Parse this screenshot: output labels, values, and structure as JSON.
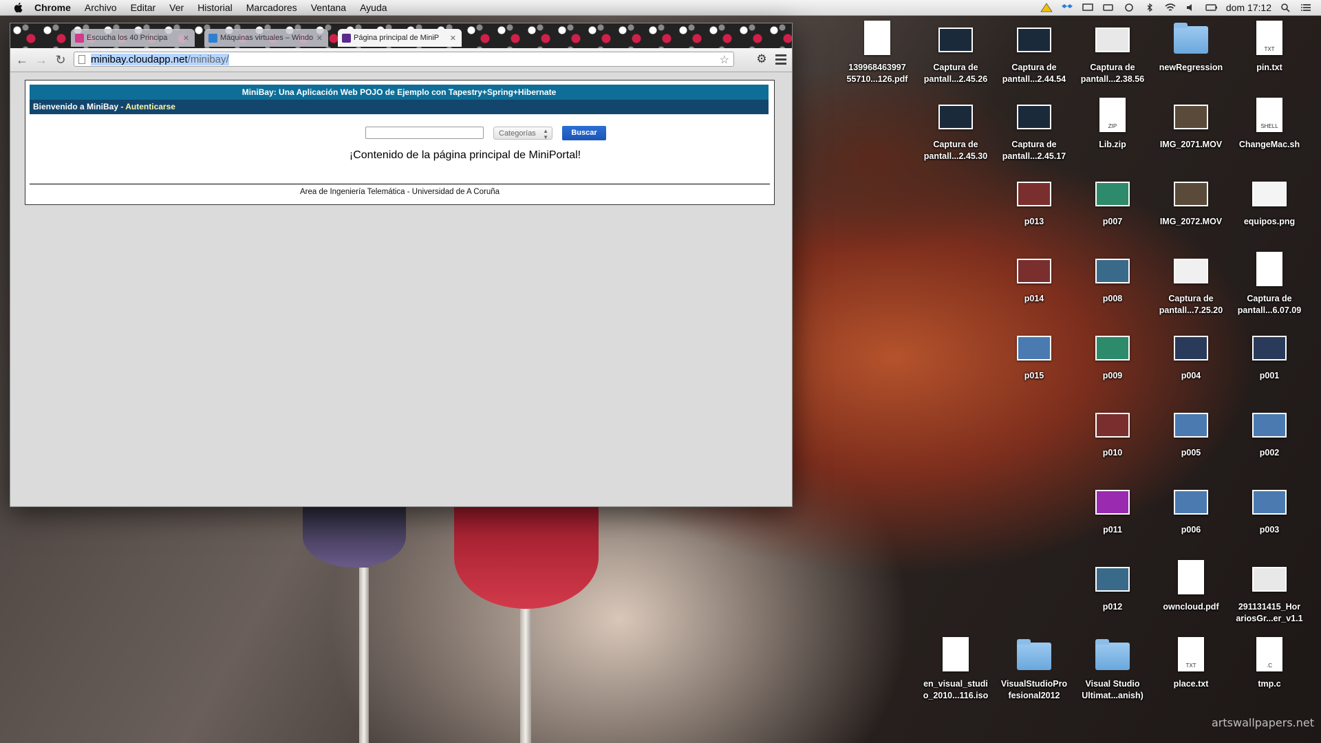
{
  "menubar": {
    "app_name": "Chrome",
    "items": [
      "Archivo",
      "Editar",
      "Ver",
      "Historial",
      "Marcadores",
      "Ventana",
      "Ayuda"
    ],
    "clock": "dom 17:12"
  },
  "browser": {
    "tabs": [
      {
        "title": "Escucha los 40 Principa",
        "favicon_color": "#d23a8c",
        "active": false
      },
      {
        "title": "Máquinas virtuales – Windo",
        "favicon_color": "#2f7fd1",
        "active": false
      },
      {
        "title": "Página principal de MiniP",
        "favicon_color": "#5b2a8f",
        "active": true
      }
    ],
    "url_host": "minibay.cloudapp.net",
    "url_path": "/minibay/"
  },
  "page": {
    "header_title": "MiniBay: Una Aplicación Web POJO de Ejemplo con Tapestry+Spring+Hibernate",
    "welcome_text": "Bienvenido a MiniBay - ",
    "login_link": "Autenticarse",
    "search_value": "",
    "category_selected": "Categorías",
    "search_button": "Buscar",
    "main_message": "¡Contenido de la página principal de MiniPortal!",
    "footer": "Area de Ingeniería Telemática - Universidad de A Coruña"
  },
  "desktop": {
    "icons": [
      {
        "name": "139968463997 55710...126.pdf",
        "kind": "doc",
        "tag": ""
      },
      {
        "name": "Captura de pantall...2.45.26",
        "kind": "thumb",
        "color": "#1a2a3a"
      },
      {
        "name": "Captura de pantall...2.44.54",
        "kind": "thumb",
        "color": "#1a2a3a"
      },
      {
        "name": "Captura de pantall...2.38.56",
        "kind": "thumb",
        "color": "#e8e8e8"
      },
      {
        "name": "newRegression",
        "kind": "folder"
      },
      {
        "name": "pin.txt",
        "kind": "doc",
        "tag": "TXT"
      },
      {
        "name": "Captura de pantall...2.45.30",
        "kind": "thumb",
        "color": "#1a2a3a"
      },
      {
        "name": "Captura de pantall...2.45.17",
        "kind": "thumb",
        "color": "#1a2a3a"
      },
      {
        "name": "Lib.zip",
        "kind": "doc",
        "tag": "ZIP"
      },
      {
        "name": "IMG_2071.MOV",
        "kind": "thumb",
        "color": "#5a4a3a"
      },
      {
        "name": "ChangeMac.sh",
        "kind": "doc",
        "tag": "SHELL"
      },
      {
        "name": "p013",
        "kind": "thumb",
        "color": "#7a2e2e"
      },
      {
        "name": "p007",
        "kind": "thumb",
        "color": "#2d8a6a"
      },
      {
        "name": "IMG_2072.MOV",
        "kind": "thumb",
        "color": "#5a4a3a"
      },
      {
        "name": "equipos.png",
        "kind": "thumb",
        "color": "#f4f4f4"
      },
      {
        "name": "p014",
        "kind": "thumb",
        "color": "#7a2e2e"
      },
      {
        "name": "p008",
        "kind": "thumb",
        "color": "#3a6a8a"
      },
      {
        "name": "Captura de pantall...7.25.20",
        "kind": "thumb",
        "color": "#f0f0f0"
      },
      {
        "name": "Captura de pantall...6.07.09",
        "kind": "doc",
        "tag": ""
      },
      {
        "name": "p015",
        "kind": "thumb",
        "color": "#4a7ab0"
      },
      {
        "name": "p009",
        "kind": "thumb",
        "color": "#2d8a6a"
      },
      {
        "name": "p004",
        "kind": "thumb",
        "color": "#2a3a5a"
      },
      {
        "name": "p001",
        "kind": "thumb",
        "color": "#2a3a5a"
      },
      {
        "name": "p010",
        "kind": "thumb",
        "color": "#7a2e2e"
      },
      {
        "name": "p005",
        "kind": "thumb",
        "color": "#4a7ab0"
      },
      {
        "name": "p002",
        "kind": "thumb",
        "color": "#4a7ab0"
      },
      {
        "name": "p011",
        "kind": "thumb",
        "color": "#9a2ab0"
      },
      {
        "name": "p006",
        "kind": "thumb",
        "color": "#4a7ab0"
      },
      {
        "name": "p003",
        "kind": "thumb",
        "color": "#4a7ab0"
      },
      {
        "name": "p012",
        "kind": "thumb",
        "color": "#3a6a8a"
      },
      {
        "name": "owncloud.pdf",
        "kind": "doc",
        "tag": ""
      },
      {
        "name": "291131415_Hor ariosGr...er_v1.1",
        "kind": "thumb",
        "color": "#e8e8e8"
      },
      {
        "name": "en_visual_studi o_2010...116.iso",
        "kind": "doc",
        "tag": ""
      },
      {
        "name": "VisualStudioPro fesional2012",
        "kind": "folder"
      },
      {
        "name": "Visual Studio Ultimat...anish)",
        "kind": "folder"
      },
      {
        "name": "place.txt",
        "kind": "doc",
        "tag": "TXT"
      },
      {
        "name": "tmp.c",
        "kind": "doc",
        "tag": ".C"
      }
    ]
  },
  "wallpaper_credit": "artswallpapers.net"
}
